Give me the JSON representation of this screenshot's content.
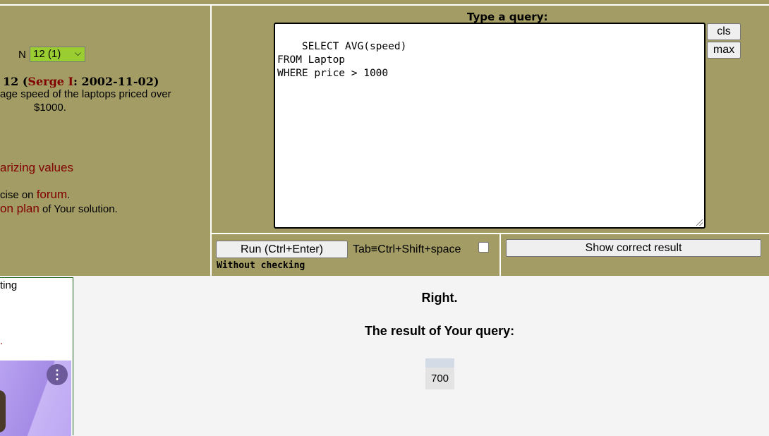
{
  "left_panel": {
    "n_label": "N",
    "exercise_select_value": "12 (1)",
    "exercise_number": "12 (",
    "exercise_author": "Serge I",
    "exercise_date": ": 2002-11-02)",
    "description_line1": "age speed of the laptops priced over",
    "description_line2": "$1000.",
    "topic_link": "arizing values",
    "forum_prefix": "cise on ",
    "forum_link": "forum",
    "forum_suffix": ".",
    "plan_link": "on plan",
    "plan_suffix": " of Your solution."
  },
  "query": {
    "title": "Type a query:",
    "text": "SELECT AVG(speed)\nFROM Laptop\nWHERE price > 1000",
    "cls_label": "cls",
    "max_label": "max"
  },
  "run_bar": {
    "run_label": "Run (Ctrl+Enter)",
    "tab_label": "Tab≡Ctrl+Shift+space",
    "without_checking": "Without checking",
    "show_correct_label": "Show correct result"
  },
  "ad": {
    "text1": "ting",
    "text2": ".",
    "menu_glyph": "⋮"
  },
  "result": {
    "status": "Right.",
    "title": "The result of Your query:",
    "rows": [
      [
        "700"
      ]
    ]
  },
  "colors": {
    "panel_bg": "#a39c64",
    "link": "#800000",
    "select_bg": "#9acd32"
  }
}
